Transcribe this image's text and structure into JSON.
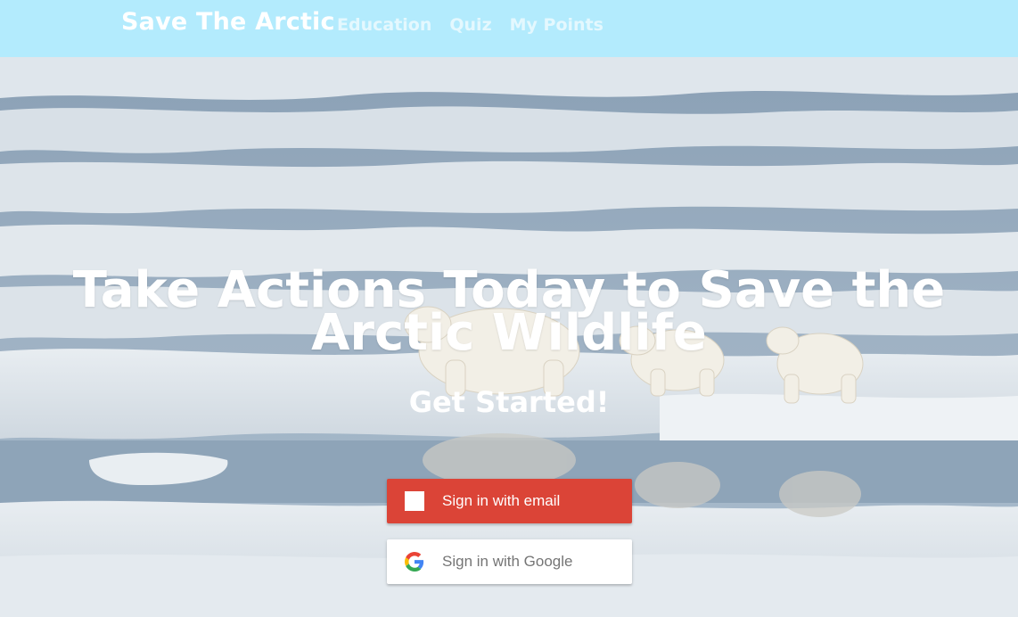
{
  "navbar": {
    "brand": "Save The Arctic",
    "links": [
      "Education",
      "Quiz",
      "My Points"
    ]
  },
  "hero": {
    "headline": "Take Actions Today to Save the Arctic Wildlife",
    "subheadline": "Get Started!",
    "background": "polar-bears-on-sea-ice-photo"
  },
  "auth": {
    "email_label": "Sign in with email",
    "google_label": "Sign in with Google",
    "email_color": "#db4437",
    "google_color": "#ffffff"
  },
  "colors": {
    "navbar_bg": "#b3ebfd",
    "text": "#ffffff"
  }
}
